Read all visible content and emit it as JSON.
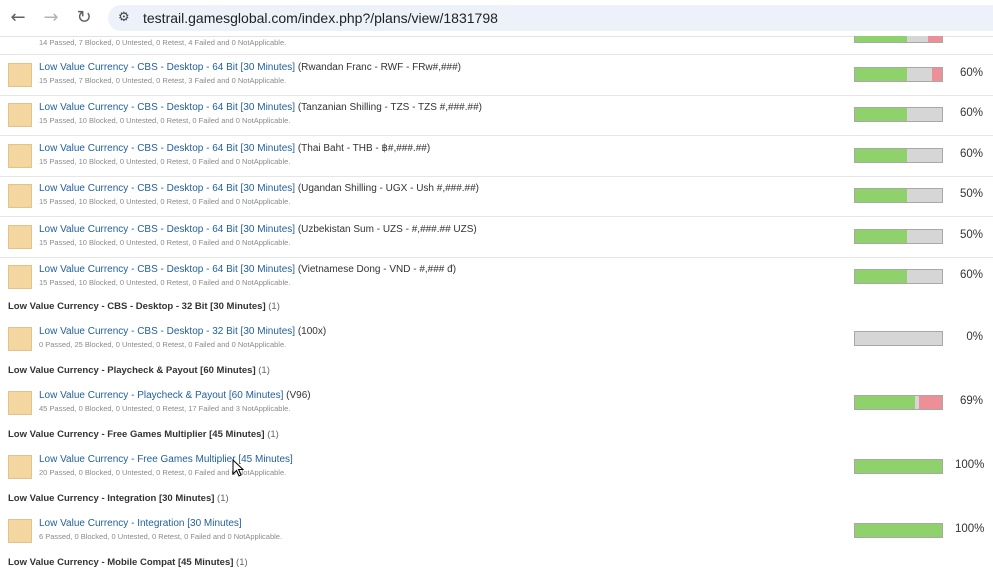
{
  "browser": {
    "back_icon": "back-arrow-icon",
    "forward_icon": "forward-arrow-icon",
    "reload_icon": "reload-icon",
    "site_settings_icon": "tune-icon",
    "url": "testrail.gamesglobal.com/index.php?/plans/view/1831798"
  },
  "top_partial": {
    "sub": "14 Passed, 7 Blocked, 0 Untested, 0 Retest, 4 Failed and 0 NotApplicable."
  },
  "runs": [
    {
      "link": "Low Value Currency - CBS - Desktop - 64 Bit [30 Minutes]",
      "extra": "(Rwandan Franc - RWF - FRw#,###)",
      "sub": "15 Passed, 7 Blocked, 0 Untested, 0 Retest, 3 Failed and 0 NotApplicable.",
      "pct": "60%",
      "passed": 0.6,
      "failed": 0.12
    },
    {
      "link": "Low Value Currency - CBS - Desktop - 64 Bit [30 Minutes]",
      "extra": "(Tanzanian Shilling - TZS - TZS #,###.##)",
      "sub": "15 Passed, 10 Blocked, 0 Untested, 0 Retest, 0 Failed and 0 NotApplicable.",
      "pct": "60%",
      "passed": 0.6,
      "failed": 0
    },
    {
      "link": "Low Value Currency - CBS - Desktop - 64 Bit [30 Minutes]",
      "extra": "(Thai Baht - THB - ฿#,###.##)",
      "sub": "15 Passed, 10 Blocked, 0 Untested, 0 Retest, 0 Failed and 0 NotApplicable.",
      "pct": "60%",
      "passed": 0.6,
      "failed": 0
    },
    {
      "link": "Low Value Currency - CBS - Desktop - 64 Bit [30 Minutes]",
      "extra": "(Ugandan Shilling - UGX - Ush #,###.##)",
      "sub": "15 Passed, 10 Blocked, 0 Untested, 0 Retest, 0 Failed and 0 NotApplicable.",
      "pct": "50%",
      "passed": 0.6,
      "failed": 0
    },
    {
      "link": "Low Value Currency - CBS - Desktop - 64 Bit [30 Minutes]",
      "extra": "(Uzbekistan Sum - UZS - #,###.## UZS)",
      "sub": "15 Passed, 10 Blocked, 0 Untested, 0 Retest, 0 Failed and 0 NotApplicable.",
      "pct": "50%",
      "passed": 0.6,
      "failed": 0
    },
    {
      "link": "Low Value Currency - CBS - Desktop - 64 Bit [30 Minutes]",
      "extra": "(Vietnamese Dong - VND - #,### đ)",
      "sub": "15 Passed, 10 Blocked, 0 Untested, 0 Retest, 0 Failed and 0 NotApplicable.",
      "pct": "60%",
      "passed": 0.6,
      "failed": 0
    }
  ],
  "groups": [
    {
      "title": "Low Value Currency - CBS - Desktop - 32 Bit [30 Minutes]",
      "count": "(1)",
      "run": {
        "link": "Low Value Currency - CBS - Desktop - 32 Bit [30 Minutes]",
        "extra": "(100x)",
        "sub": "0 Passed, 25 Blocked, 0 Untested, 0 Retest, 0 Failed and 0 NotApplicable.",
        "pct": "0%",
        "passed": 0,
        "failed": 0
      }
    },
    {
      "title": "Low Value Currency - Playcheck & Payout [60 Minutes]",
      "count": "(1)",
      "run": {
        "link": "Low Value Currency - Playcheck & Payout [60 Minutes]",
        "extra": "(V96)",
        "sub": "45 Passed, 0 Blocked, 0 Untested, 0 Retest, 17 Failed and 3 NotApplicable.",
        "pct": "69%",
        "passed": 0.69,
        "failed": 0.26
      }
    },
    {
      "title": "Low Value Currency - Free Games Multiplier [45 Minutes]",
      "count": "(1)",
      "run": {
        "link": "Low Value Currency - Free Games Multiplier [45 Minutes]",
        "extra": "",
        "sub": "20 Passed, 0 Blocked, 0 Untested, 0 Retest, 0 Failed and 0 NotApplicable.",
        "pct": "100%",
        "passed": 1,
        "failed": 0
      }
    },
    {
      "title": "Low Value Currency - Integration [30 Minutes]",
      "count": "(1)",
      "run": {
        "link": "Low Value Currency - Integration [30 Minutes]",
        "extra": "",
        "sub": "6 Passed, 0 Blocked, 0 Untested, 0 Retest, 0 Failed and 0 NotApplicable.",
        "pct": "100%",
        "passed": 1,
        "failed": 0
      }
    },
    {
      "title": "Low Value Currency - Mobile Compat [45 Minutes]",
      "count": "(1)"
    }
  ],
  "colors": {
    "passed": "#8fd16a",
    "failed": "#ec8f97",
    "untested": "#d6d6d6",
    "link": "#1f5f9e"
  }
}
